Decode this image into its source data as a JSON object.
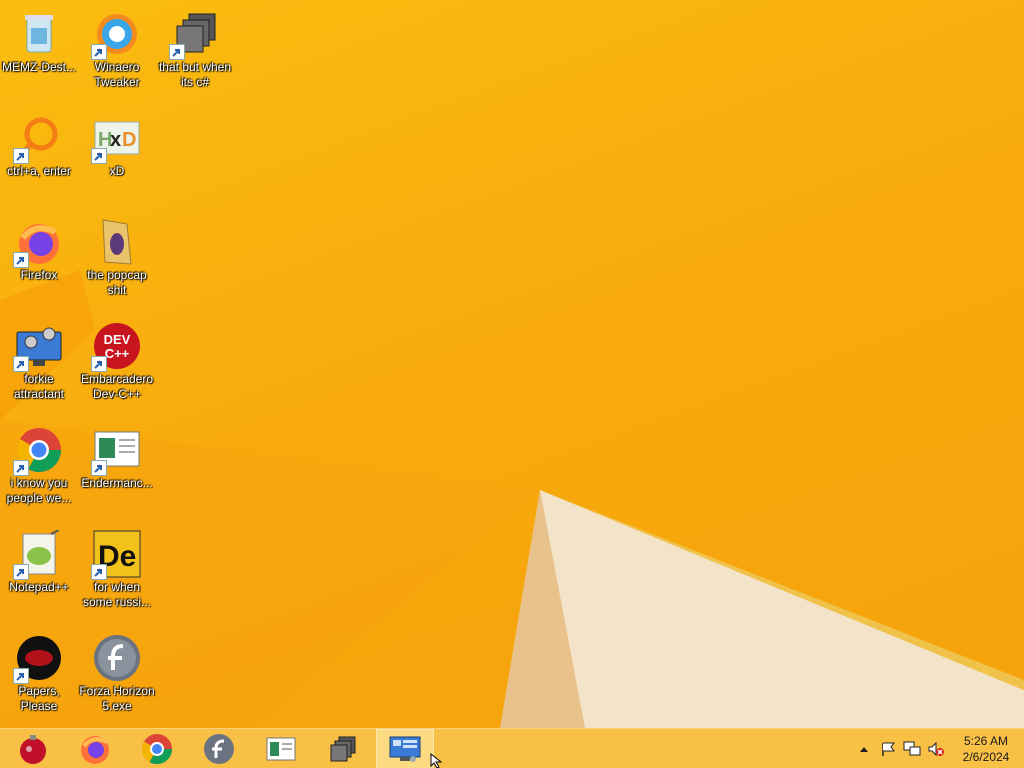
{
  "desktop": {
    "icons": [
      {
        "label": "MEMZ-Dest...",
        "icon": "recycle-bin-icon"
      },
      {
        "label": "Winaero Tweaker",
        "icon": "winaero-tweaker-icon"
      },
      {
        "label": "that but when its c#",
        "icon": "stacked-windows-icon"
      },
      {
        "label": "ctrl+a, enter",
        "icon": "magnifier-icon"
      },
      {
        "label": "xD",
        "icon": "hxd-icon"
      },
      {
        "label": "Firefox",
        "icon": "firefox-icon"
      },
      {
        "label": "the popcap shit",
        "icon": "folder-icon"
      },
      {
        "label": "forkie attractant",
        "icon": "computer-gears-icon"
      },
      {
        "label": "Embarcadero Dev-C++",
        "icon": "devcpp-icon"
      },
      {
        "label": "i know you people we...",
        "icon": "chrome-icon"
      },
      {
        "label": "Endermanc...",
        "icon": "document-window-icon"
      },
      {
        "label": "Notepad++",
        "icon": "notepadpp-icon"
      },
      {
        "label": "for when some russi...",
        "icon": "de-icon"
      },
      {
        "label": "Papers, Please",
        "icon": "papers-please-icon"
      },
      {
        "label": "Forza Horizon 5.exe",
        "icon": "flash-icon"
      }
    ]
  },
  "taskbar": {
    "apps": [
      {
        "name": "ornament-app-icon"
      },
      {
        "name": "firefox-taskbar-icon"
      },
      {
        "name": "chrome-taskbar-icon"
      },
      {
        "name": "flash-taskbar-icon"
      },
      {
        "name": "document-taskbar-icon"
      },
      {
        "name": "stacked-windows-taskbar-icon"
      },
      {
        "name": "control-panel-taskbar-icon",
        "active": true
      }
    ],
    "clock": {
      "time": "5:26 AM",
      "date": "2/6/2024"
    }
  },
  "colors": {
    "wallpaper": "#fbbd10",
    "taskbar": "#f8be3c"
  }
}
